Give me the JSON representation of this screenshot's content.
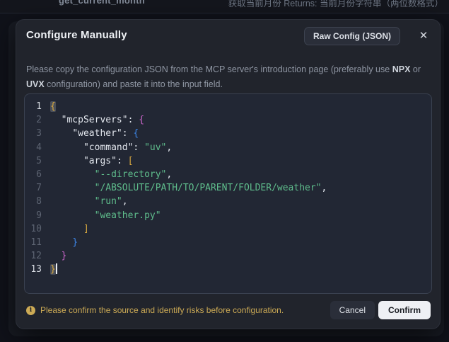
{
  "colors": {
    "page-bg": "#10121a",
    "modal-bg": "#21242c",
    "editor-bg": "#222734",
    "editor-border": "#3a4150",
    "title": "#eef1f5",
    "desc": "#8f96a3",
    "desc-bold": "#ced3db",
    "bg-text": "#838b99",
    "bg-text-dim": "#6e7684",
    "code": "#e2e6ed",
    "string": "#5fbd8c",
    "gold": "#d9a940",
    "magenta": "#cc66cc",
    "blue": "#3d86e8",
    "linenum": "#5d6472",
    "linenum-active": "#d6dae1",
    "match-bg": "#4a4f5a",
    "warning": "#ccaa55",
    "btn-dark-bg": "#2a2e39",
    "btn-border": "#3d4350",
    "confirm-bg": "#eef0f4",
    "confirm-text": "#171a20"
  },
  "background_page": {
    "tool_name": "get_current_month",
    "tool_desc": "获取当前月份 Returns: 当前月份字符串（两位数格式）"
  },
  "modal": {
    "title": "Configure Manually",
    "raw_config_button": "Raw Config (JSON)",
    "close_icon": "✕",
    "description": {
      "part1": "Please copy the configuration JSON from the MCP server's introduction page (preferably use ",
      "bold1": "NPX",
      "part2": " or ",
      "bold2": "UVX",
      "part3": " configuration) and paste it into the input field."
    },
    "footer": {
      "warning_icon": "i",
      "warning_text": "Please confirm the source and identify risks before configuration.",
      "cancel_label": "Cancel",
      "confirm_label": "Confirm"
    }
  },
  "editor": {
    "lines": [
      {
        "n": "1",
        "active": true,
        "seg": [
          {
            "t": "{",
            "c": "gold",
            "m": true
          }
        ]
      },
      {
        "n": "2",
        "seg": [
          {
            "t": "  ",
            "c": "plain"
          },
          {
            "t": "\"mcpServers\"",
            "c": "key"
          },
          {
            "t": ": ",
            "c": "plain"
          },
          {
            "t": "{",
            "c": "magenta"
          }
        ]
      },
      {
        "n": "3",
        "seg": [
          {
            "t": "    ",
            "c": "plain"
          },
          {
            "t": "\"weather\"",
            "c": "key"
          },
          {
            "t": ": ",
            "c": "plain"
          },
          {
            "t": "{",
            "c": "blue"
          }
        ]
      },
      {
        "n": "4",
        "seg": [
          {
            "t": "      ",
            "c": "plain"
          },
          {
            "t": "\"command\"",
            "c": "key"
          },
          {
            "t": ": ",
            "c": "plain"
          },
          {
            "t": "\"uv\"",
            "c": "str"
          },
          {
            "t": ",",
            "c": "plain"
          }
        ]
      },
      {
        "n": "5",
        "seg": [
          {
            "t": "      ",
            "c": "plain"
          },
          {
            "t": "\"args\"",
            "c": "key"
          },
          {
            "t": ": ",
            "c": "plain"
          },
          {
            "t": "[",
            "c": "gold"
          }
        ]
      },
      {
        "n": "6",
        "seg": [
          {
            "t": "        ",
            "c": "plain"
          },
          {
            "t": "\"--directory\"",
            "c": "str"
          },
          {
            "t": ",",
            "c": "plain"
          }
        ]
      },
      {
        "n": "7",
        "seg": [
          {
            "t": "        ",
            "c": "plain"
          },
          {
            "t": "\"/ABSOLUTE/PATH/TO/PARENT/FOLDER/weather\"",
            "c": "str"
          },
          {
            "t": ",",
            "c": "plain"
          }
        ]
      },
      {
        "n": "8",
        "seg": [
          {
            "t": "        ",
            "c": "plain"
          },
          {
            "t": "\"run\"",
            "c": "str"
          },
          {
            "t": ",",
            "c": "plain"
          }
        ]
      },
      {
        "n": "9",
        "seg": [
          {
            "t": "        ",
            "c": "plain"
          },
          {
            "t": "\"weather.py\"",
            "c": "str"
          }
        ]
      },
      {
        "n": "10",
        "seg": [
          {
            "t": "      ",
            "c": "plain"
          },
          {
            "t": "]",
            "c": "gold"
          }
        ]
      },
      {
        "n": "11",
        "seg": [
          {
            "t": "    ",
            "c": "plain"
          },
          {
            "t": "}",
            "c": "blue"
          }
        ]
      },
      {
        "n": "12",
        "seg": [
          {
            "t": "  ",
            "c": "plain"
          },
          {
            "t": "}",
            "c": "magenta"
          }
        ]
      },
      {
        "n": "13",
        "active": true,
        "cursor": true,
        "seg": [
          {
            "t": "}",
            "c": "gold",
            "m": true
          }
        ]
      }
    ]
  }
}
